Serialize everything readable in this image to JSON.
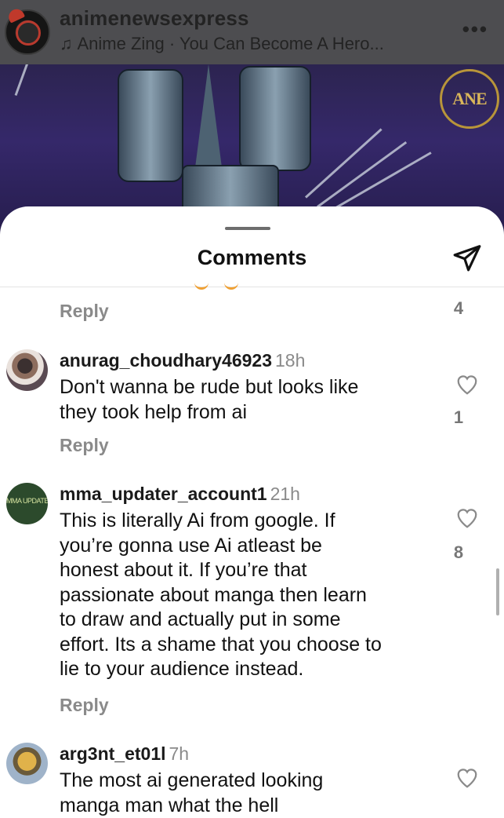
{
  "header": {
    "account": "animenewsexpress",
    "music": "Anime Zing · You Can Become A Hero...",
    "watermark": "ANE"
  },
  "sheet": {
    "title": "Comments"
  },
  "prev_comment": {
    "reply_label": "Reply",
    "likes": "4"
  },
  "comments": [
    {
      "username": "anurag_choudhary46923",
      "time": "18h",
      "text": "Don't wanna be rude but looks like\nthey took help from ai",
      "reply_label": "Reply",
      "likes": "1"
    },
    {
      "username": "mma_updater_account1",
      "time": "21h",
      "avatar_text": "MMA UPDATER",
      "text": "This is literally Ai from google. If\nyou’re gonna use Ai atleast be\nhonest about it. If you’re that\npassionate about manga then learn\nto draw and actually put in some\neffort. Its a shame that you choose to\nlie to your audience instead.",
      "reply_label": "Reply",
      "likes": "8"
    },
    {
      "username": "arg3nt_et01l",
      "time": "7h",
      "text": "The most ai generated looking\nmanga man what the hell"
    }
  ],
  "colors": {
    "accent_text": "#111111",
    "muted": "#8a8a8a",
    "header_dim": "#4d4d50"
  }
}
